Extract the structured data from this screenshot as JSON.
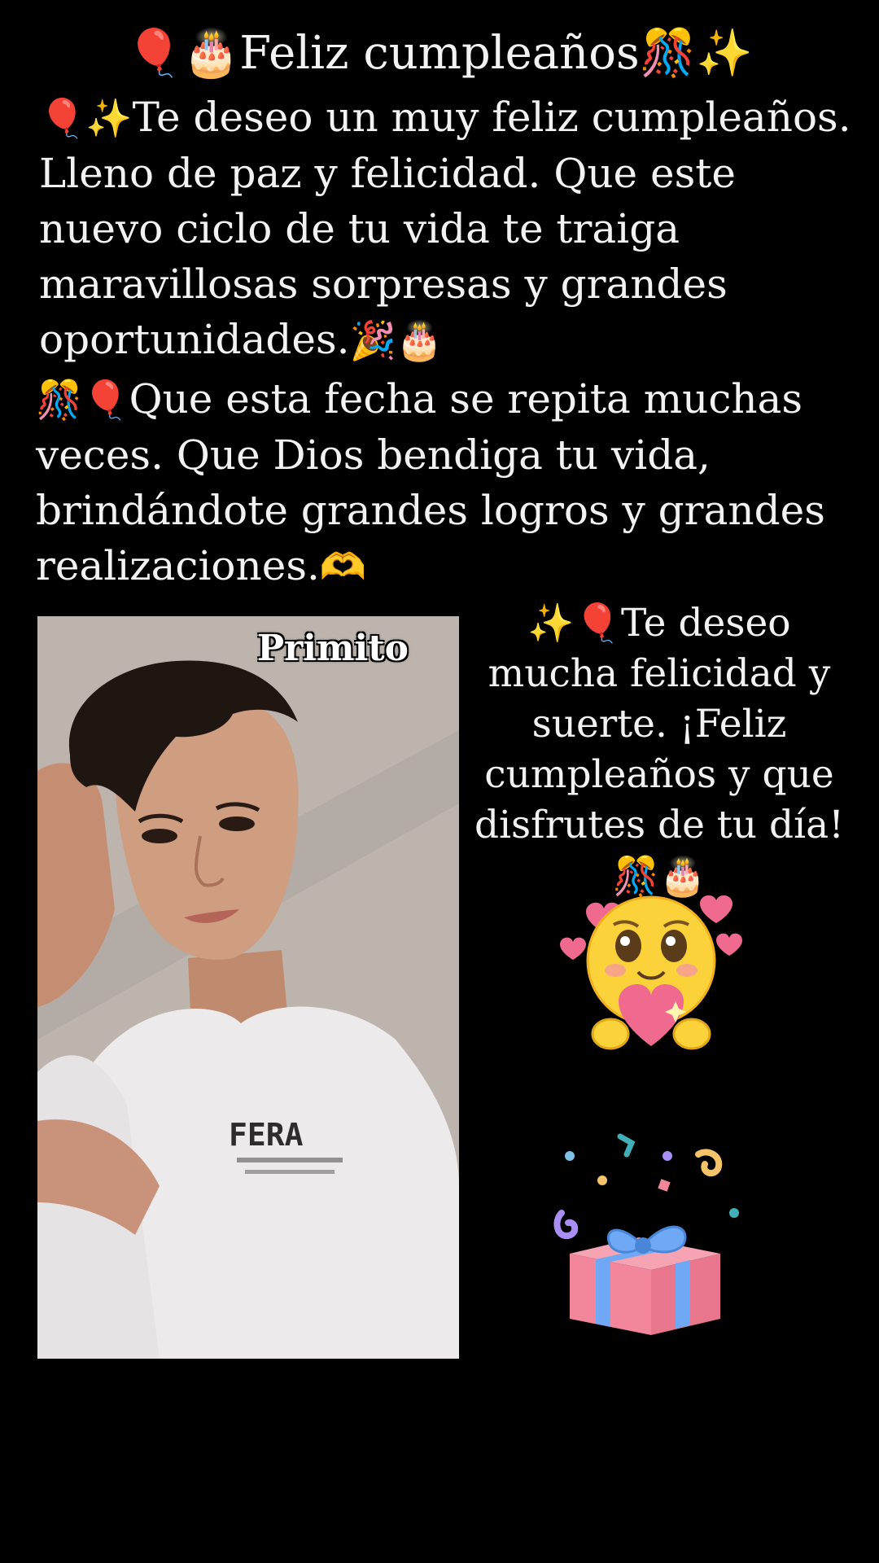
{
  "title": "🎈🎂Feliz cumpleaños🎊✨",
  "paragraph_1": {
    "lead_emoji": "🎈✨",
    "text": "Te deseo un muy feliz cumpleaños. Lleno de paz y felicidad. Que este nuevo ciclo de tu vida te traiga maravillosas sorpresas y grandes oportunidades.",
    "tail_emoji": "🎉🎂"
  },
  "paragraph_2": {
    "lead_emoji": "🎊🎈",
    "text": "Que esta fecha se repita muchas veces. Que Dios bendiga tu vida, brindándote grandes logros y grandes realizaciones.",
    "tail_emoji": "🫶"
  },
  "photo": {
    "caption": "Primito",
    "shirt_print": "FERA"
  },
  "paragraph_3": {
    "lead_emoji": "✨🎈",
    "text": "Te deseo mucha felicidad y suerte. ¡Feliz cumpleaños y que disfrutes de tu día!",
    "tail_emoji": "🎊🎂"
  },
  "stickers": {
    "face_icon": "smiling-face-hugging-heart-icon",
    "gift_icon": "gift-with-confetti-icon"
  },
  "colors": {
    "background": "#000000",
    "text": "#f2f2f2",
    "heart_pink": "#f06a8f",
    "gift_pink": "#f2869a",
    "ribbon_blue": "#6fa8f5"
  }
}
